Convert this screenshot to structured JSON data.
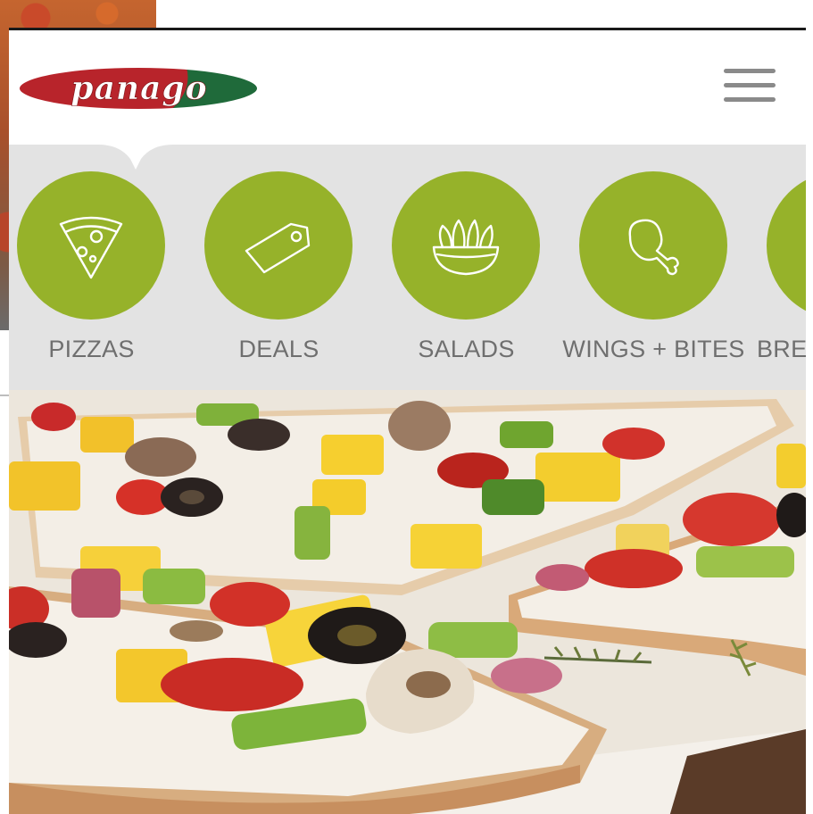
{
  "header": {
    "logo_text": "panago",
    "menu_icon": "hamburger-icon"
  },
  "categories": [
    {
      "label": "PIZZAS",
      "icon": "pizza-slice-icon"
    },
    {
      "label": "DEALS",
      "icon": "price-tag-icon"
    },
    {
      "label": "SALADS",
      "icon": "salad-bowl-icon"
    },
    {
      "label": "WINGS + BITES",
      "icon": "chicken-leg-icon"
    },
    {
      "label": "BRE",
      "icon": "bread-icon"
    }
  ],
  "colors": {
    "brand_red": "#b8242b",
    "brand_green": "#1f6a3a",
    "category_green": "#96b22a",
    "category_bar_bg": "#e3e3e3",
    "label_gray": "#6f6f6f"
  },
  "hero": {
    "image": "flatbread-veggie-pizza-photo"
  }
}
